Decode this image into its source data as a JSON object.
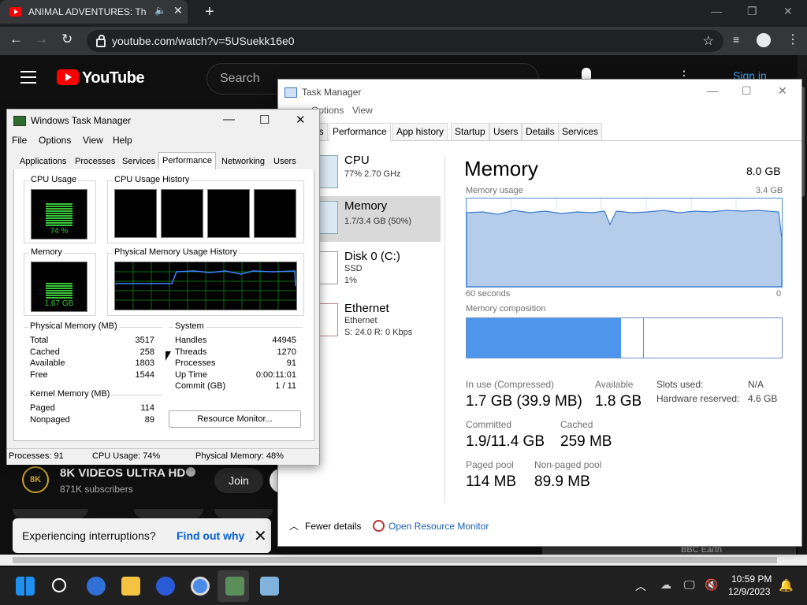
{
  "browser": {
    "tab_title": "ANIMAL ADVENTURES: The",
    "url": "youtube.com/watch?v=5USuekk16e0"
  },
  "youtube": {
    "logo_text": "YouTube",
    "search_placeholder": "Search",
    "sign_in": "Sign in",
    "channel_name": "8K VIDEOS ULTRA HD",
    "channel_badge": "8K",
    "subscribers": "871K subscribers",
    "join_label": "Join",
    "interruption_text": "Experiencing interruptions?",
    "interruption_link": "Find out why",
    "bbc_earth": "BBC Earth"
  },
  "tm_new": {
    "title": "Task Manager",
    "menu": [
      "Options",
      "View"
    ],
    "tabs": [
      "es",
      "Performance",
      "App history",
      "Startup",
      "Users",
      "Details",
      "Services"
    ],
    "resources": [
      {
        "name": "CPU",
        "sub1": "77%  2.70 GHz",
        "sub2": ""
      },
      {
        "name": "Memory",
        "sub1": "1.7/3.4 GB (50%)",
        "sub2": ""
      },
      {
        "name": "Disk 0 (C:)",
        "sub1": "SSD",
        "sub2": "1%"
      },
      {
        "name": "Ethernet",
        "sub1": "Ethernet",
        "sub2": "S: 24.0  R: 0 Kbps"
      }
    ],
    "heading": "Memory",
    "total": "8.0 GB",
    "usage_label": "Memory usage",
    "usage_max": "3.4 GB",
    "time_left": "60 seconds",
    "time_right": "0",
    "composition_label": "Memory composition",
    "composition_in_use_fraction": 0.49,
    "composition_modified_fraction": 0.07,
    "stats": {
      "in_use_label": "In use (Compressed)",
      "in_use_value": "1.7 GB (39.9 MB)",
      "available_label": "Available",
      "available_value": "1.8 GB",
      "committed_label": "Committed",
      "committed_value": "1.9/11.4 GB",
      "cached_label": "Cached",
      "cached_value": "259 MB",
      "paged_label": "Paged pool",
      "paged_value": "114 MB",
      "nonpaged_label": "Non-paged pool",
      "nonpaged_value": "89.9 MB",
      "slots_label": "Slots used:",
      "slots_value": "N/A",
      "hw_label": "Hardware reserved:",
      "hw_value": "4.6 GB"
    },
    "fewer_details": "Fewer details",
    "open_rm": "Open Resource Monitor"
  },
  "tm_old": {
    "title": "Windows Task Manager",
    "menu": [
      "File",
      "Options",
      "View",
      "Help"
    ],
    "tabs": [
      "Applications",
      "Processes",
      "Services",
      "Performance",
      "Networking",
      "Users"
    ],
    "cpu_usage_label": "CPU Usage",
    "cpu_usage_value": "74 %",
    "cpu_usage_fraction": 0.74,
    "cpu_history_label": "CPU Usage History",
    "memory_label": "Memory",
    "memory_value": "1.67 GB",
    "memory_fraction": 0.49,
    "phys_history_label": "Physical Memory Usage History",
    "physical": {
      "label": "Physical Memory (MB)",
      "rows": [
        {
          "k": "Total",
          "v": "3517"
        },
        {
          "k": "Cached",
          "v": "258"
        },
        {
          "k": "Available",
          "v": "1803"
        },
        {
          "k": "Free",
          "v": "1544"
        }
      ]
    },
    "kernel": {
      "label": "Kernel Memory (MB)",
      "rows": [
        {
          "k": "Paged",
          "v": "114"
        },
        {
          "k": "Nonpaged",
          "v": "89"
        }
      ]
    },
    "system": {
      "label": "System",
      "rows": [
        {
          "k": "Handles",
          "v": "44945"
        },
        {
          "k": "Threads",
          "v": "1270"
        },
        {
          "k": "Processes",
          "v": "91"
        },
        {
          "k": "Up Time",
          "v": "0:00:11:01"
        },
        {
          "k": "Commit (GB)",
          "v": "1 / 11"
        }
      ]
    },
    "rm_button": "Resource Monitor...",
    "status": {
      "processes": "Processes: 91",
      "cpu": "CPU Usage: 74%",
      "memory": "Physical Memory: 48%"
    }
  },
  "taskbar": {
    "time": "10:59 PM",
    "date": "12/9/2023",
    "icons": [
      "start-icon",
      "search-icon",
      "edge-beta-icon",
      "file-explorer-icon",
      "firefox-icon",
      "chrome-icon",
      "task-manager-icon",
      "performance-monitor-icon"
    ]
  }
}
